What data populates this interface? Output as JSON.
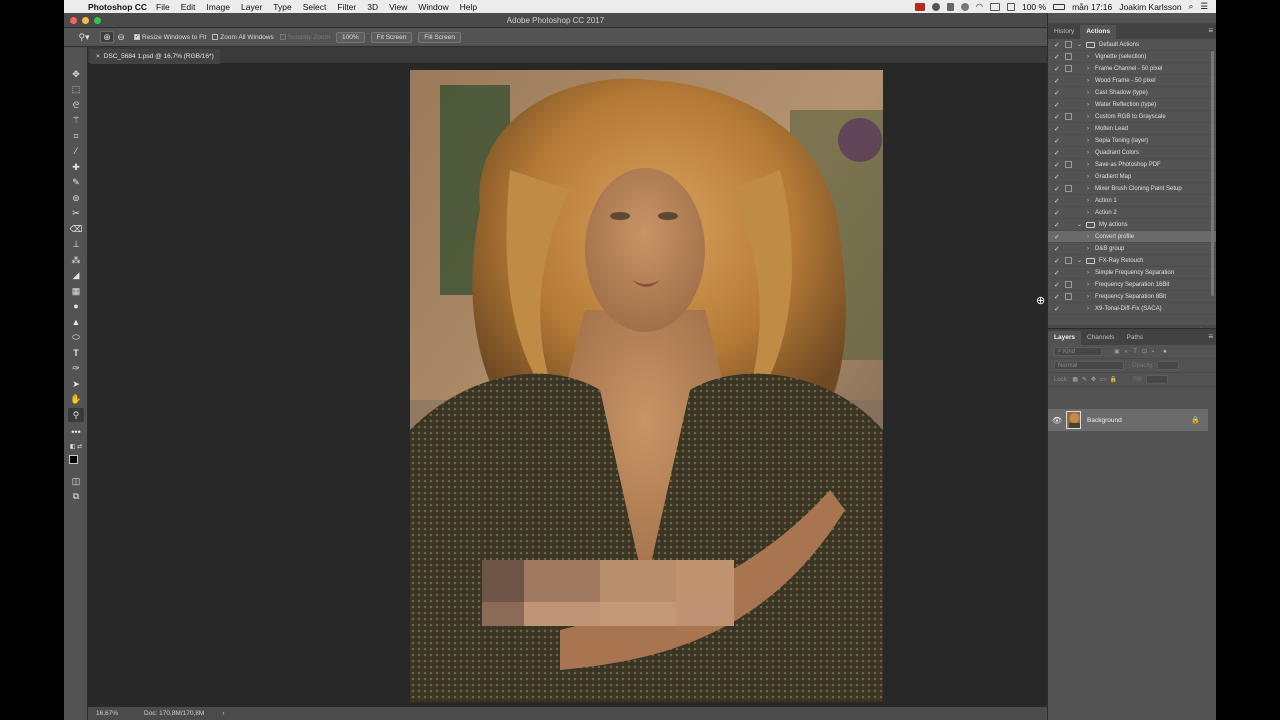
{
  "menubar": {
    "app_name": "Photoshop CC",
    "items": [
      "File",
      "Edit",
      "Image",
      "Layer",
      "Type",
      "Select",
      "Filter",
      "3D",
      "View",
      "Window",
      "Help"
    ],
    "battery": "100 %",
    "clock": "mån 17:16",
    "user": "Joakim Karlsson"
  },
  "window": {
    "title": "Adobe Photoshop CC 2017"
  },
  "options_bar": {
    "resize_windows": "Resize Windows to Fit",
    "zoom_all": "Zoom All Windows",
    "scrubby_zoom": "Scrubby Zoom",
    "zoom_value": "100%",
    "fit_screen": "Fit Screen",
    "fill_screen": "Fill Screen"
  },
  "document": {
    "tab_label": "DSC_5684 1.psd @ 16,7% (RGB/16*)"
  },
  "status": {
    "zoom": "16,67%",
    "doc": "Doc: 170,8M/170,8M",
    "arrow": "›"
  },
  "actions_panel": {
    "tabs": [
      "History",
      "Actions"
    ],
    "rows": [
      {
        "label": "Default Actions",
        "level": 0,
        "folder": true,
        "open": true,
        "dlg": true
      },
      {
        "label": "Vignette (selection)",
        "level": 1,
        "dlg": true
      },
      {
        "label": "Frame Channel - 50 pixel",
        "level": 1,
        "dlg": true
      },
      {
        "label": "Wood Frame - 50 pixel",
        "level": 1,
        "dlg": false
      },
      {
        "label": "Cast Shadow (type)",
        "level": 1,
        "dlg": false
      },
      {
        "label": "Water Reflection (type)",
        "level": 1,
        "dlg": false
      },
      {
        "label": "Custom RGB to Grayscale",
        "level": 1,
        "dlg": true
      },
      {
        "label": "Molten Lead",
        "level": 1,
        "dlg": false
      },
      {
        "label": "Sepia Toning (layer)",
        "level": 1,
        "dlg": false
      },
      {
        "label": "Quadrant Colors",
        "level": 1,
        "dlg": false
      },
      {
        "label": "Save as Photoshop PDF",
        "level": 1,
        "dlg": true
      },
      {
        "label": "Gradient Map",
        "level": 1,
        "dlg": false
      },
      {
        "label": "Mixer Brush Cloning Paint Setup",
        "level": 1,
        "dlg": true
      },
      {
        "label": "Action 1",
        "level": 1,
        "dlg": false
      },
      {
        "label": "Action 2",
        "level": 1,
        "dlg": false
      },
      {
        "label": "My actions",
        "level": 0,
        "folder": true,
        "open": true,
        "dlg": false
      },
      {
        "label": "Convert profile",
        "level": 1,
        "dlg": false,
        "highlight": true
      },
      {
        "label": "D&B group",
        "level": 1,
        "dlg": false
      },
      {
        "label": "FX-Ray Retouch",
        "level": 0,
        "folder": true,
        "open": true,
        "dlg": true
      },
      {
        "label": "Simple Frequency Separation",
        "level": 1,
        "dlg": false
      },
      {
        "label": "Frequency Separation 16Bit",
        "level": 1,
        "dlg": true
      },
      {
        "label": "Frequency Separation 8Bit",
        "level": 1,
        "dlg": true
      },
      {
        "label": "X9-Tonal-Diff-Fix (SACA)",
        "level": 1,
        "dlg": false
      }
    ]
  },
  "layers_panel": {
    "tabs": [
      "Layers",
      "Channels",
      "Paths"
    ],
    "filter_kind": "Kind",
    "blend_mode": "Normal",
    "opacity_label": "Opacity:",
    "lock_label": "Lock:",
    "fill_label": "Fill:",
    "layer_name": "Background"
  },
  "colors": {
    "accent": "#e8e8e8"
  }
}
